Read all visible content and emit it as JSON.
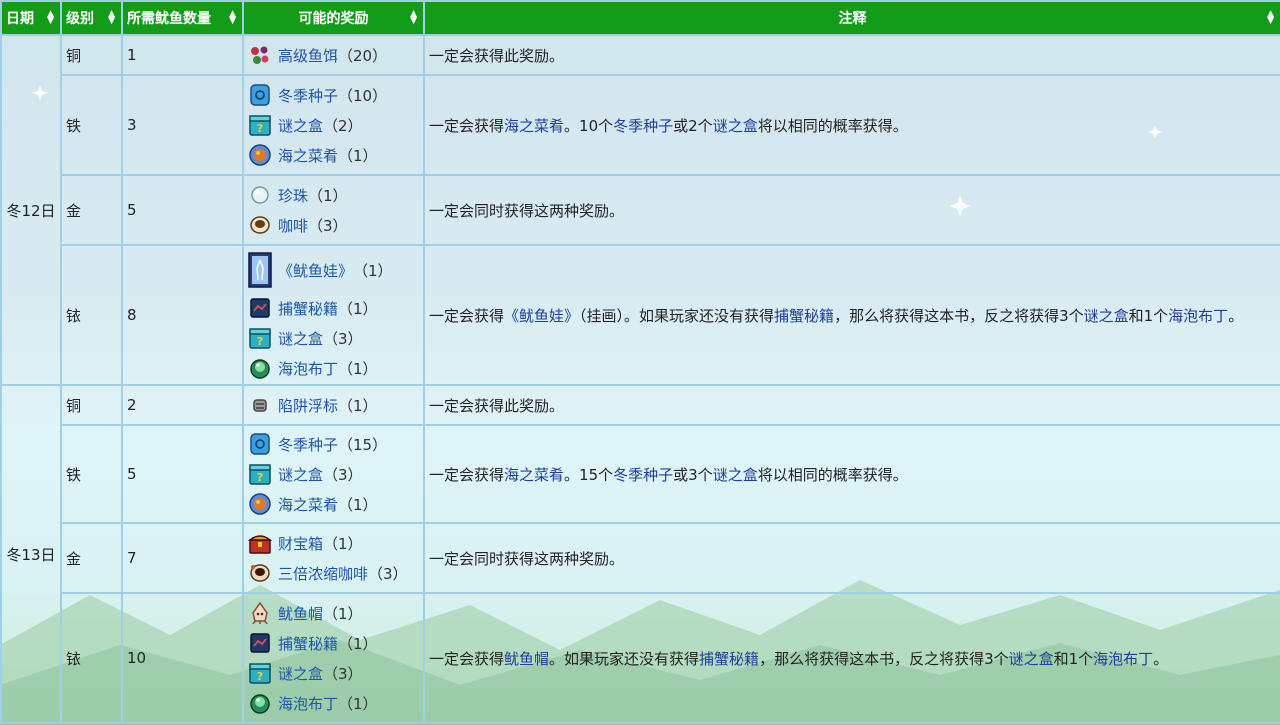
{
  "headers": {
    "date": "日期",
    "level": "级别",
    "squid_count": "所需鱿鱼数量",
    "rewards": "可能的奖励",
    "notes": "注释"
  },
  "groups": [
    {
      "date": "冬12日",
      "rows": [
        {
          "level": "铜",
          "count": "1",
          "rewards": [
            {
              "name": "高级鱼饵",
              "qty": "（20）",
              "icon": "berry-bait-icon"
            }
          ],
          "note": [
            {
              "t": "一定会获得此奖励。"
            }
          ]
        },
        {
          "level": "铁",
          "count": "3",
          "rewards": [
            {
              "name": "冬季种子",
              "qty": "（10）",
              "icon": "seed-packet-icon"
            },
            {
              "name": "谜之盒",
              "qty": "（2）",
              "icon": "mystery-box-icon"
            },
            {
              "name": "海之菜肴",
              "qty": "（1）",
              "icon": "seafood-dish-icon"
            }
          ],
          "note": [
            {
              "t": "一定会获得"
            },
            {
              "t": "海之菜肴",
              "link": true
            },
            {
              "t": "。10个"
            },
            {
              "t": "冬季种子",
              "link": true
            },
            {
              "t": "或2个"
            },
            {
              "t": "谜之盒",
              "link": true
            },
            {
              "t": "将以相同的概率获得。"
            }
          ]
        },
        {
          "level": "金",
          "count": "5",
          "rewards": [
            {
              "name": "珍珠",
              "qty": "（1）",
              "icon": "pearl-icon"
            },
            {
              "name": "咖啡",
              "qty": "（3）",
              "icon": "coffee-icon"
            }
          ],
          "note": [
            {
              "t": "一定会同时获得这两种奖励。"
            }
          ]
        },
        {
          "level": "铱",
          "count": "8",
          "rewards": [
            {
              "name": "《鱿鱼娃》",
              "qty": "（1）",
              "icon": "painting-icon"
            },
            {
              "name": "捕蟹秘籍",
              "qty": "（1）",
              "icon": "book-icon"
            },
            {
              "name": "谜之盒",
              "qty": "（3）",
              "icon": "mystery-box-icon"
            },
            {
              "name": "海泡布丁",
              "qty": "（1）",
              "icon": "pudding-icon"
            }
          ],
          "note": [
            {
              "t": "一定会获得"
            },
            {
              "t": "《鱿鱼娃》",
              "link": true
            },
            {
              "t": "（挂画）。如果玩家还没有获得"
            },
            {
              "t": "捕蟹秘籍",
              "link": true
            },
            {
              "t": "，那么将获得这本书，反之将获得3个"
            },
            {
              "t": "谜之盒",
              "link": true
            },
            {
              "t": "和1个"
            },
            {
              "t": "海泡布丁",
              "link": true
            },
            {
              "t": "。"
            }
          ]
        }
      ]
    },
    {
      "date": "冬13日",
      "rows": [
        {
          "level": "铜",
          "count": "2",
          "rewards": [
            {
              "name": "陷阱浮标",
              "qty": "（1）",
              "icon": "trap-bobber-icon"
            }
          ],
          "note": [
            {
              "t": "一定会获得此奖励。"
            }
          ]
        },
        {
          "level": "铁",
          "count": "5",
          "rewards": [
            {
              "name": "冬季种子",
              "qty": "（15）",
              "icon": "seed-packet-icon"
            },
            {
              "name": "谜之盒",
              "qty": "（3）",
              "icon": "mystery-box-icon"
            },
            {
              "name": "海之菜肴",
              "qty": "（1）",
              "icon": "seafood-dish-icon"
            }
          ],
          "note": [
            {
              "t": "一定会获得"
            },
            {
              "t": "海之菜肴",
              "link": true
            },
            {
              "t": "。15个"
            },
            {
              "t": "冬季种子",
              "link": true
            },
            {
              "t": "或3个"
            },
            {
              "t": "谜之盒",
              "link": true
            },
            {
              "t": "将以相同的概率获得。"
            }
          ]
        },
        {
          "level": "金",
          "count": "7",
          "rewards": [
            {
              "name": "财宝箱",
              "qty": "（1）",
              "icon": "treasure-chest-icon"
            },
            {
              "name": "三倍浓缩咖啡",
              "qty": "（3）",
              "icon": "triple-espresso-icon"
            }
          ],
          "note": [
            {
              "t": "一定会同时获得这两种奖励。"
            }
          ]
        },
        {
          "level": "铱",
          "count": "10",
          "rewards": [
            {
              "name": "鱿鱼帽",
              "qty": "（1）",
              "icon": "squid-hat-icon"
            },
            {
              "name": "捕蟹秘籍",
              "qty": "（1）",
              "icon": "book-icon"
            },
            {
              "name": "谜之盒",
              "qty": "（3）",
              "icon": "mystery-box-icon"
            },
            {
              "name": "海泡布丁",
              "qty": "（1）",
              "icon": "pudding-icon"
            }
          ],
          "note": [
            {
              "t": "一定会获得"
            },
            {
              "t": "鱿鱼帽",
              "link": true
            },
            {
              "t": "。如果玩家还没有获得"
            },
            {
              "t": "捕蟹秘籍",
              "link": true
            },
            {
              "t": "，那么将获得这本书，反之将获得3个"
            },
            {
              "t": "谜之盒",
              "link": true
            },
            {
              "t": "和1个"
            },
            {
              "t": "海泡布丁",
              "link": true
            },
            {
              "t": "。"
            }
          ]
        }
      ]
    }
  ],
  "colors": {
    "header_bg": "#139b1a",
    "border": "#9fd0e8",
    "link": "#1e55a8"
  }
}
